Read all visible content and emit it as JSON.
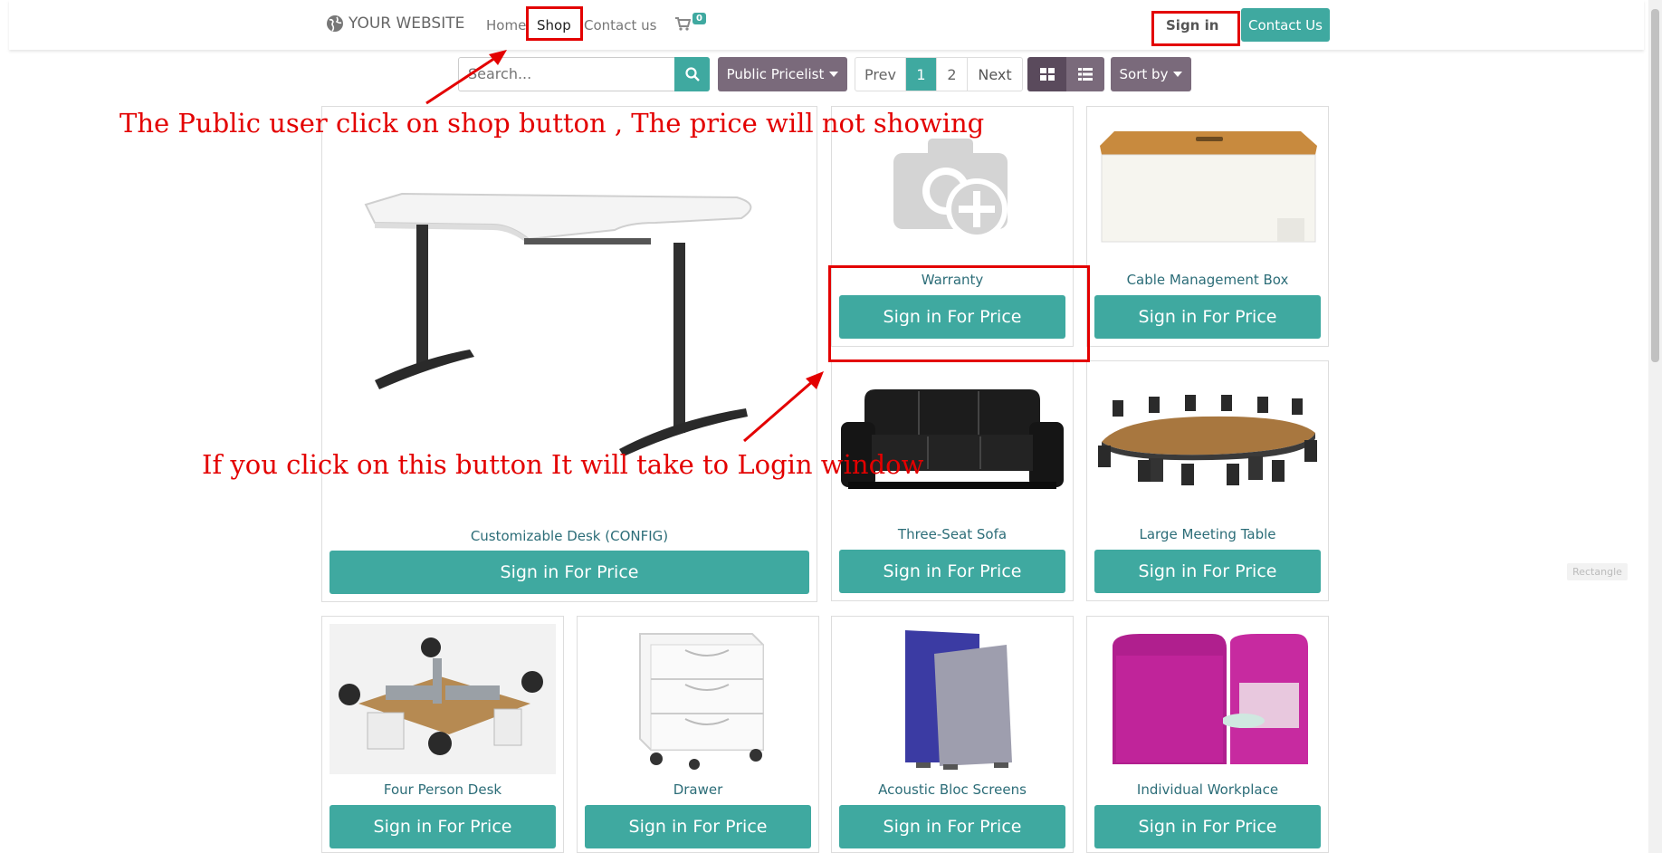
{
  "brand": {
    "logo_text": "YOUR WEBSITE"
  },
  "nav": {
    "home": "Home",
    "shop": "Shop",
    "contact": "Contact us",
    "cart_count": "0"
  },
  "header": {
    "signin": "Sign in",
    "contact_btn": "Contact Us"
  },
  "toolbar": {
    "search_placeholder": "Search...",
    "pricelist": "Public Pricelist",
    "pager": {
      "prev": "Prev",
      "page1": "1",
      "page2": "2",
      "next": "Next"
    },
    "sort_by": "Sort by"
  },
  "products": [
    {
      "name": "Customizable Desk (CONFIG)",
      "button": "Sign in For Price"
    },
    {
      "name": "Warranty",
      "button": "Sign in For Price"
    },
    {
      "name": "Cable Management Box",
      "button": "Sign in For Price"
    },
    {
      "name": "Three-Seat Sofa",
      "button": "Sign in For Price"
    },
    {
      "name": "Large Meeting Table",
      "button": "Sign in For Price"
    },
    {
      "name": "Four Person Desk",
      "button": "Sign in For Price"
    },
    {
      "name": "Drawer",
      "button": "Sign in For Price"
    },
    {
      "name": "Acoustic Bloc Screens",
      "button": "Sign in For Price"
    },
    {
      "name": "Individual Workplace",
      "button": "Sign in For Price"
    }
  ],
  "annotations": {
    "shop_note": "The Public user click on shop button , The price will not showing",
    "button_note": "If you click on this button It will take to Login window",
    "rect_label": "Rectangle"
  },
  "colors": {
    "accent": "#3fa9a0",
    "secondary": "#7a6a7b",
    "annotation": "#e30000"
  },
  "icons": [
    "globe-icon",
    "cart-icon",
    "search-icon",
    "grid-view-icon",
    "list-view-icon",
    "camera-plus-icon"
  ]
}
